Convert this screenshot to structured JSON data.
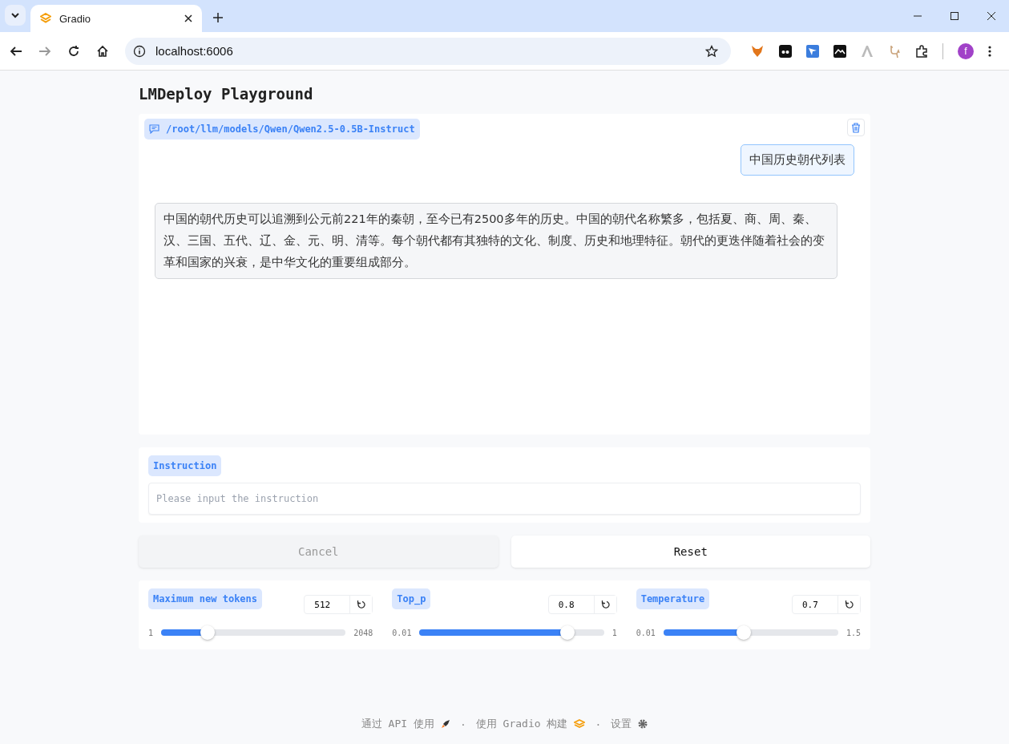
{
  "browser": {
    "tab_title": "Gradio",
    "url": "localhost:6006",
    "profile_initial": "f"
  },
  "title": "LMDeploy Playground",
  "chatbot": {
    "model_label": "/root/llm/models/Qwen/Qwen2.5-0.5B-Instruct",
    "messages": [
      {
        "kind": "user",
        "text": "中国历史朝代列表"
      },
      {
        "kind": "bot",
        "text": "中国的朝代历史可以追溯到公元前221年的秦朝，至今已有2500多年的历史。中国的朝代名称繁多，包括夏、商、周、秦、汉、三国、五代、辽、金、元、明、清等。每个朝代都有其独特的文化、制度、历史和地理特征。朝代的更迭伴随着社会的变革和国家的兴衰，是中华文化的重要组成部分。"
      }
    ]
  },
  "instruction": {
    "label": "Instruction",
    "placeholder": "Please input the instruction"
  },
  "buttons": [
    {
      "label": "Cancel",
      "disabled": true
    },
    {
      "label": "Reset",
      "disabled": false
    }
  ],
  "sliders": [
    {
      "label": "Maximum new tokens",
      "value": "512",
      "min": "1",
      "max": "2048",
      "level": 0.25
    },
    {
      "label": "Top_p",
      "value": "0.8",
      "min": "0.01",
      "max": "1",
      "level": 0.8
    },
    {
      "label": "Temperature",
      "value": "0.7",
      "min": "0.01",
      "max": "1.5",
      "level": 0.46
    }
  ],
  "footer": {
    "api_link": "通过 API 使用",
    "separators": [
      "·",
      "·"
    ],
    "built_with": "使用 Gradio 构建",
    "settings": "设置"
  }
}
